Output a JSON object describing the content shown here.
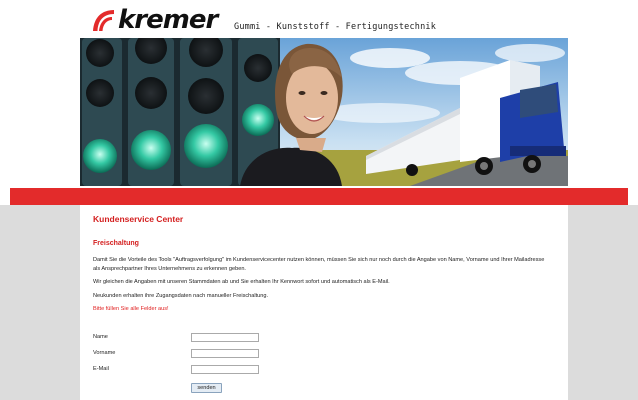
{
  "header": {
    "logo_text": "kremer",
    "tagline": "Gummi - Kunststoff - Fertigungstechnik"
  },
  "banner": {
    "alt": "traffic lights, woman, truck"
  },
  "content": {
    "title": "Kundenservice Center",
    "subtitle": "Freischaltung",
    "paragraph1": "Damit Sie die Vorteile des Tools \"Auftragsverfolgung\" im Kundenservicecenter nutzen können, müssen Sie sich nur noch durch die Angabe von Name, Vorname und Ihrer Mailadresse als Ansprechpartner Ihres Unternehmens zu erkennen geben.",
    "paragraph2": "Wir gleichen die Angaben mit unseren Stammdaten ab und Sie erhalten Ihr Kennwort sofort und automatisch als E-Mail.",
    "paragraph3": "Neukunden erhalten ihre Zugangsdaten nach manueller Freischaltung.",
    "required_note": "Bitte füllen Sie alle Felder aus!"
  },
  "form": {
    "name_label": "Name",
    "name_value": "",
    "vorname_label": "Vorname",
    "vorname_value": "",
    "email_label": "E-Mail",
    "email_value": "",
    "submit_label": "senden"
  },
  "colors": {
    "accent": "#e32b2b",
    "heading": "#d42020",
    "side": "#dcdcdc"
  }
}
